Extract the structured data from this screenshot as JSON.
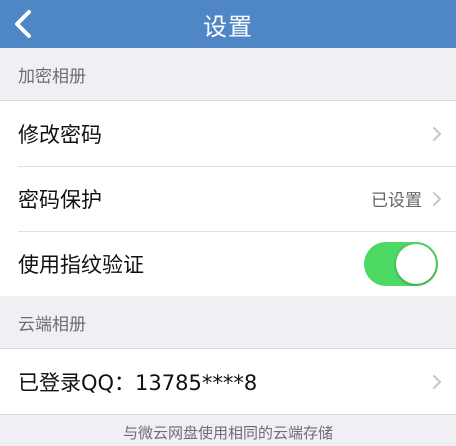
{
  "nav": {
    "title": "设置"
  },
  "sections": {
    "encrypted_album": {
      "header": "加密相册",
      "rows": {
        "change_password": {
          "label": "修改密码"
        },
        "password_protect": {
          "label": "密码保护",
          "value": "已设置"
        },
        "fingerprint": {
          "label": "使用指纹验证",
          "enabled": true
        }
      }
    },
    "cloud_album": {
      "header": "云端相册",
      "rows": {
        "qq_account": {
          "label": "已登录QQ：13785****8"
        }
      },
      "footnote": "与微云网盘使用相同的云端存储"
    }
  },
  "colors": {
    "nav_bar": "#4f86c6",
    "toggle_on": "#4cd964",
    "background": "#efeff4"
  },
  "icons": {
    "back": "chevron-left-icon",
    "disclosure": "chevron-right-icon"
  }
}
